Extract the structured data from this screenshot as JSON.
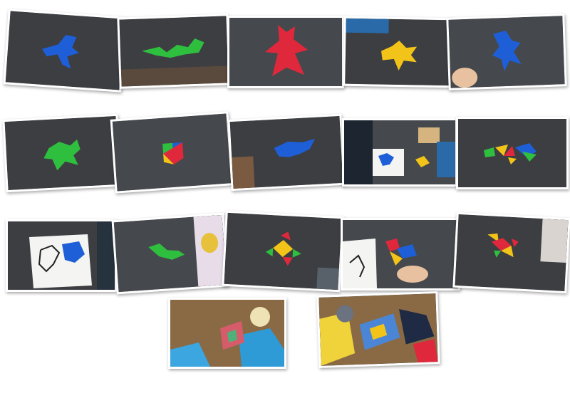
{
  "colors": {
    "blue": "#1e5fd8",
    "green": "#2fbf3f",
    "red": "#e0283c",
    "yellow": "#f2c318",
    "table": "#3c3e42",
    "paper": "#f4f4f2"
  },
  "photos": [
    {
      "name": "photo-blue-figure"
    },
    {
      "name": "photo-green-figure"
    },
    {
      "name": "photo-red-figure"
    },
    {
      "name": "photo-yellow-figure"
    },
    {
      "name": "photo-blue-bird"
    },
    {
      "name": "photo-green-turtle"
    },
    {
      "name": "photo-multicolor-square"
    },
    {
      "name": "photo-blue-boat"
    },
    {
      "name": "photo-worksheet-children"
    },
    {
      "name": "photo-multicolor-butterfly"
    },
    {
      "name": "photo-blue-outline-card"
    },
    {
      "name": "photo-green-bird"
    },
    {
      "name": "photo-multicolor-flower"
    },
    {
      "name": "photo-multicolor-figure-card"
    },
    {
      "name": "photo-red-yellow-figure"
    },
    {
      "name": "photo-children-floor-1"
    },
    {
      "name": "photo-children-floor-2"
    }
  ]
}
